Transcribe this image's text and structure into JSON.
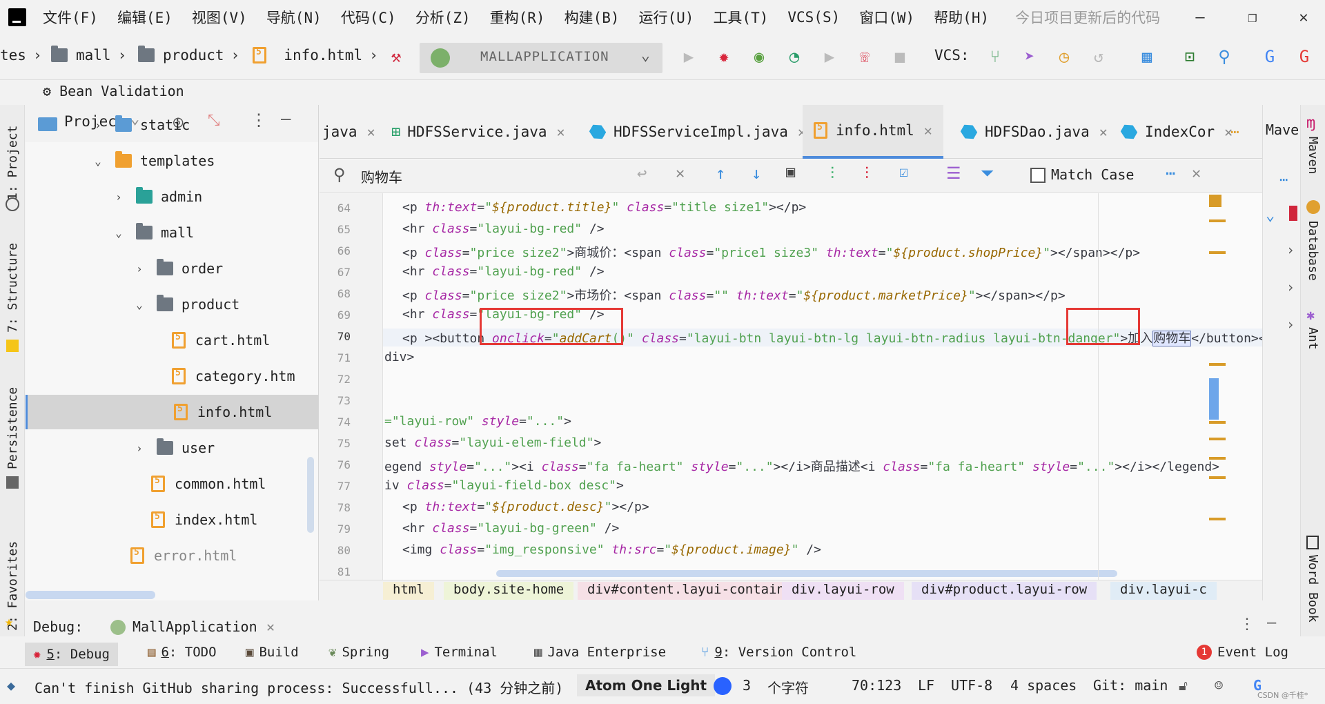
{
  "menubar": {
    "items": [
      "文件(F)",
      "编辑(E)",
      "视图(V)",
      "导航(N)",
      "代码(C)",
      "分析(Z)",
      "重构(R)",
      "构建(B)",
      "运行(U)",
      "工具(T)",
      "VCS(S)",
      "窗口(W)",
      "帮助(H)"
    ],
    "hint": "今日项目更新后的代码"
  },
  "navbar": {
    "crumbs": [
      "tes",
      "mall",
      "product",
      "info.html"
    ],
    "run_config": "MALLAPPLICATION",
    "vcs_label": "VCS:"
  },
  "bean_validation": "Bean Validation",
  "left_stripe": {
    "project": "1: Project",
    "structure": "7: Structure",
    "persistence": "Persistence",
    "favorites": "2: Favorites"
  },
  "project_panel": {
    "title": "Project",
    "rows": [
      {
        "label": "static",
        "kind": "folder-web"
      },
      {
        "label": "templates",
        "kind": "folder-orange"
      },
      {
        "label": "admin",
        "kind": "folder-teal"
      },
      {
        "label": "mall",
        "kind": "folder"
      },
      {
        "label": "order",
        "kind": "folder"
      },
      {
        "label": "product",
        "kind": "folder"
      },
      {
        "label": "cart.html",
        "kind": "html"
      },
      {
        "label": "category.htm",
        "kind": "html"
      },
      {
        "label": "info.html",
        "kind": "html"
      },
      {
        "label": "user",
        "kind": "folder"
      },
      {
        "label": "common.html",
        "kind": "html"
      },
      {
        "label": "index.html",
        "kind": "html"
      },
      {
        "label": "error.html",
        "kind": "html"
      }
    ]
  },
  "tabs": [
    {
      "label": "java",
      "kind": "plain"
    },
    {
      "label": "HDFSService.java",
      "kind": "interface"
    },
    {
      "label": "HDFSServiceImpl.java",
      "kind": "class"
    },
    {
      "label": "info.html",
      "kind": "html"
    },
    {
      "label": "HDFSDao.java",
      "kind": "class"
    },
    {
      "label": "IndexCor",
      "kind": "class"
    }
  ],
  "findbar": {
    "query": "购物车",
    "match_case": "Match Case"
  },
  "code": {
    "line_numbers": [
      "64",
      "65",
      "66",
      "67",
      "68",
      "69",
      "70",
      "71",
      "72",
      "73",
      "74",
      "75",
      "76",
      "77",
      "78",
      "79",
      "80",
      "81"
    ],
    "current_line": "70"
  },
  "breadcrumbs": [
    "html",
    "body.site-home",
    "div#content.layui-container",
    "div.layui-row",
    "div#product.layui-row",
    "div.layui-c"
  ],
  "right_panel": {
    "maven": "Mave",
    "maven_stripe": "Maven",
    "database": "Database",
    "ant": "Ant",
    "word_book": "Word Book"
  },
  "debug": {
    "label": "Debug:",
    "config": "MallApplication"
  },
  "tool_windows": [
    {
      "num": "5",
      "label": ": Debug"
    },
    {
      "num": "6",
      "label": ": TODO"
    },
    {
      "num": "",
      "label": "Build"
    },
    {
      "num": "",
      "label": "Spring"
    },
    {
      "num": "",
      "label": "Terminal"
    },
    {
      "num": "",
      "label": "Java Enterprise"
    },
    {
      "num": "9",
      "label": ": Version Control"
    }
  ],
  "event_log": {
    "count": "1",
    "label": "Event Log"
  },
  "status": {
    "message": "Can't finish GitHub sharing process: Successfull... (43 分钟之前)",
    "theme": "Atom One Light",
    "chars_count": "3",
    "chars_label": "个字符",
    "position": "70:123",
    "line_sep": "LF",
    "encoding": "UTF-8",
    "indent": "4 spaces",
    "git": "Git: main",
    "watermark": "CSDN @千桂*"
  },
  "colors": {
    "accent": "#4e8bdb",
    "highlight_box": "#e53935",
    "keyword": "#a626a4",
    "string": "#50a14f"
  }
}
